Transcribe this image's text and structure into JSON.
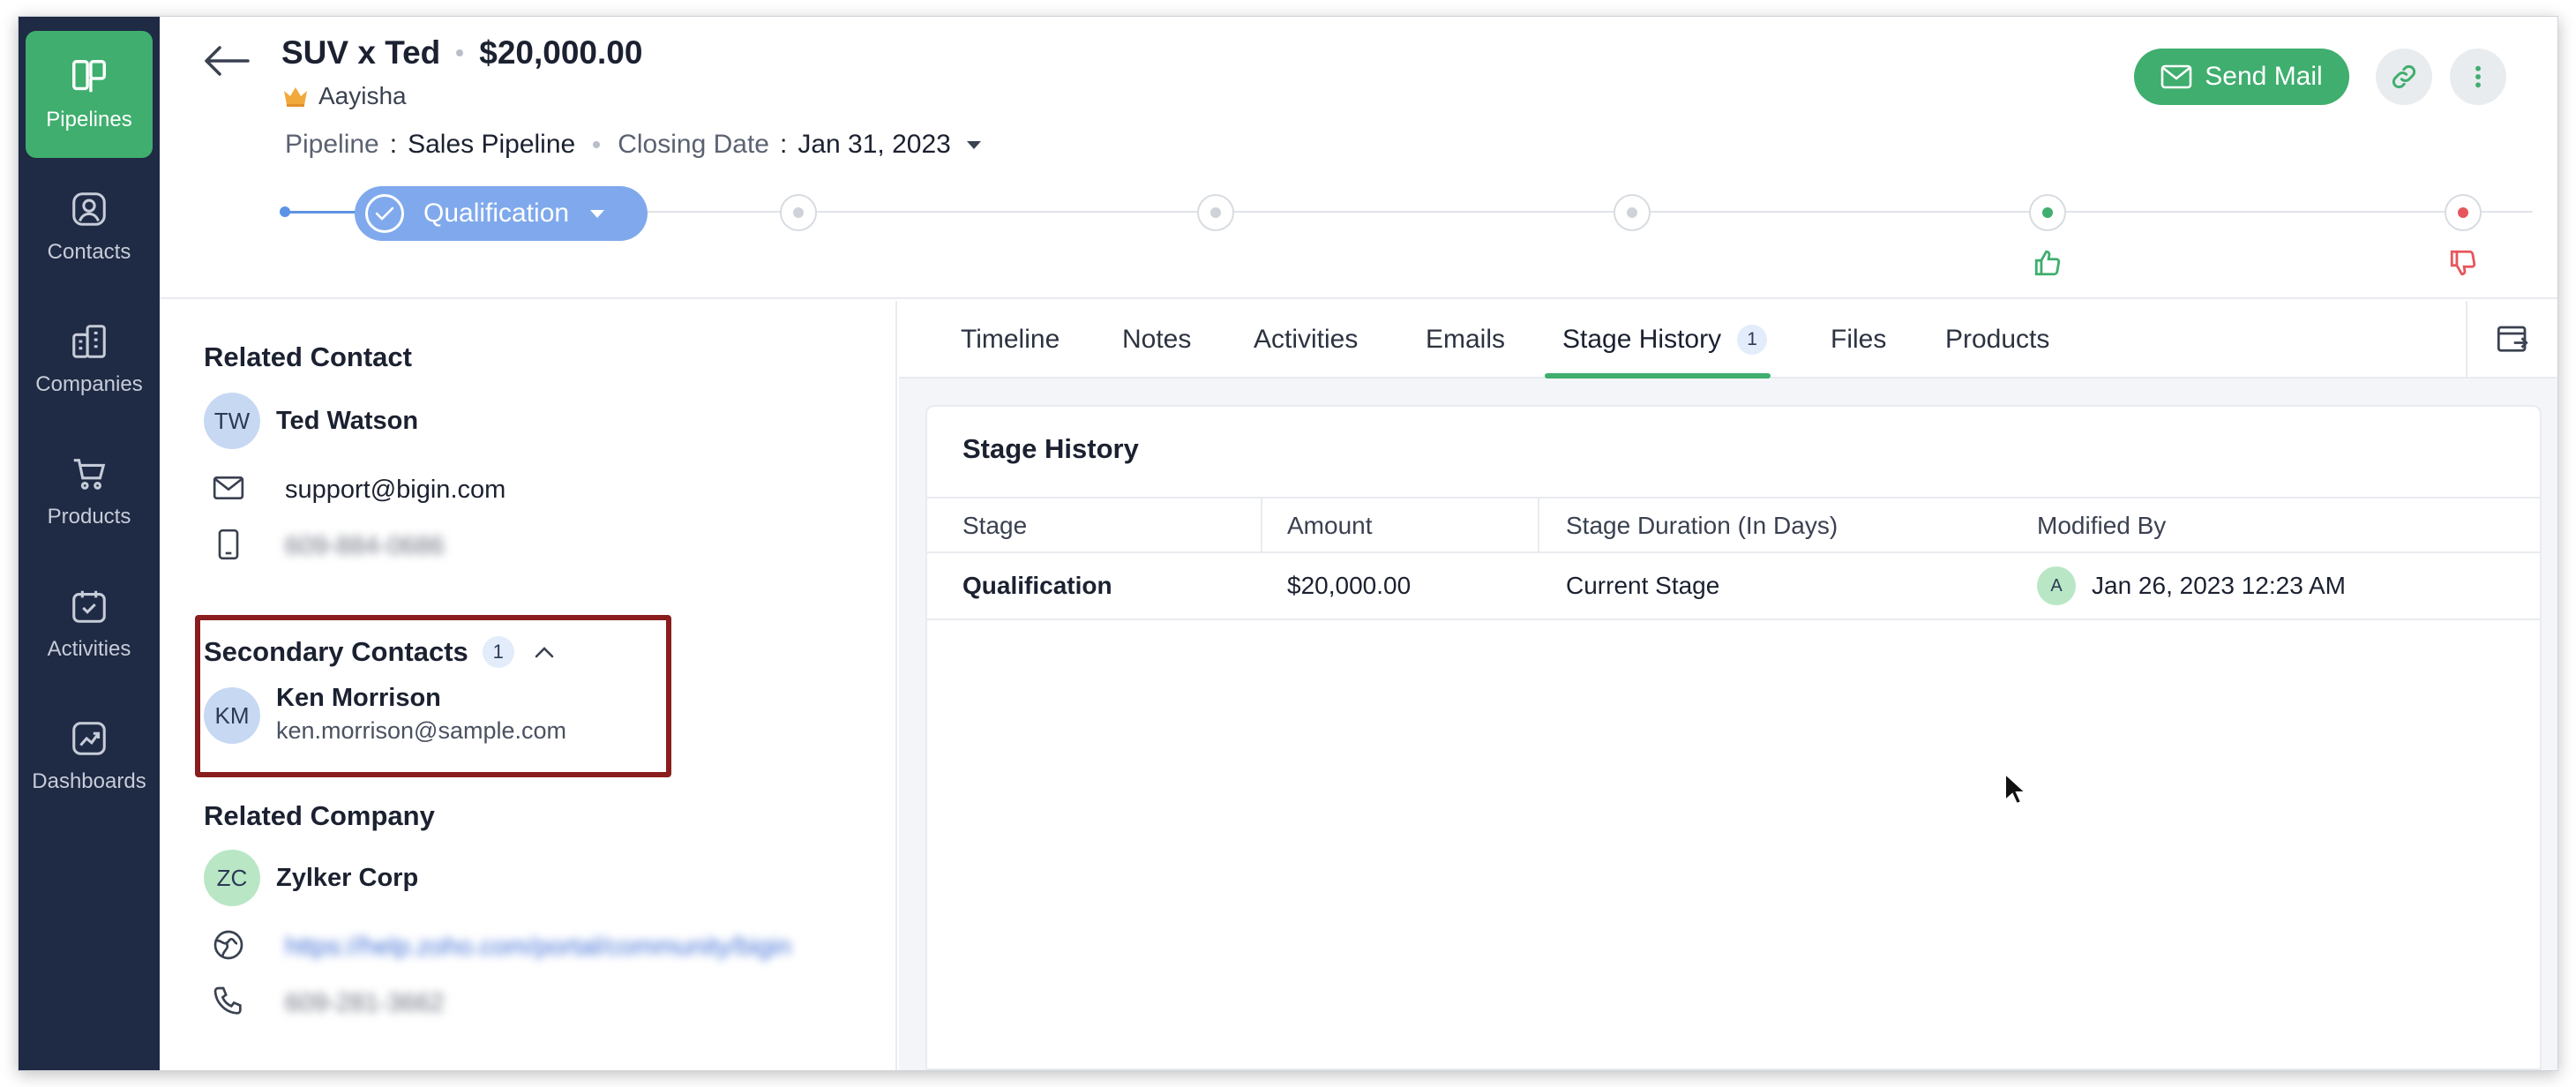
{
  "sidebar": {
    "items": [
      {
        "label": "Pipelines",
        "icon": "pipelines-icon",
        "active": true
      },
      {
        "label": "Contacts",
        "icon": "contacts-icon"
      },
      {
        "label": "Companies",
        "icon": "companies-icon"
      },
      {
        "label": "Products",
        "icon": "products-icon"
      },
      {
        "label": "Activities",
        "icon": "activities-icon"
      },
      {
        "label": "Dashboards",
        "icon": "dashboards-icon"
      }
    ]
  },
  "deal": {
    "title": "SUV x Ted",
    "amount": "$20,000.00",
    "owner": "Aayisha",
    "pipeline_key": "Pipeline",
    "pipeline_value": "Sales Pipeline",
    "closing_key": "Closing Date",
    "closing_value": "Jan 31, 2023",
    "current_stage": "Qualification"
  },
  "actions": {
    "send_mail": "Send Mail"
  },
  "related_contact": {
    "title": "Related Contact",
    "initials": "TW",
    "name": "Ted Watson",
    "email": "support@bigin.com",
    "phone": "609-884-0686"
  },
  "secondary_contacts": {
    "title": "Secondary Contacts",
    "count": "1",
    "initials": "KM",
    "name": "Ken Morrison",
    "email": "ken.morrison@sample.com"
  },
  "related_company": {
    "title": "Related Company",
    "initials": "ZC",
    "name": "Zylker Corp",
    "website": "https://help.zoho.com/portal/community/bigin",
    "phone": "609-281-3662"
  },
  "tabs": {
    "timeline": "Timeline",
    "notes": "Notes",
    "activities": "Activities",
    "emails": "Emails",
    "stage_history": "Stage History",
    "stage_history_count": "1",
    "files": "Files",
    "products": "Products"
  },
  "stage_history": {
    "title": "Stage History",
    "columns": [
      "Stage",
      "Amount",
      "Stage Duration (In Days)",
      "Modified By"
    ],
    "rows": [
      {
        "stage": "Qualification",
        "amount": "$20,000.00",
        "duration": "Current Stage",
        "modifier_initial": "A",
        "modified": "Jan 26, 2023 12:23 AM"
      }
    ]
  },
  "colors": {
    "accent_green": "#3fae6e",
    "sidebar_bg": "#1f2a44",
    "stage_blue": "#7fa9ec",
    "lost_red": "#e5575c",
    "highlight_border": "#8a1d1d"
  }
}
